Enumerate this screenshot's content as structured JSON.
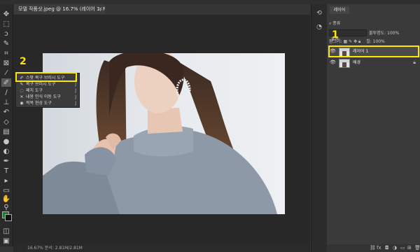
{
  "document": {
    "tab_title": "모델 작품샷.jpeg @ 16.7% (레이어 1, RGB/8#) *",
    "close_glyph": "×"
  },
  "status": {
    "text": "16.67%  문서: 2.81M/2.81M"
  },
  "toolbar": {
    "icons": [
      "move-icon",
      "marquee-icon",
      "lasso-icon",
      "quick-select-icon",
      "crop-icon",
      "frame-icon",
      "eyedropper-icon",
      "spot-healing-brush-icon",
      "brush-icon",
      "clone-stamp-icon",
      "history-brush-icon",
      "eraser-icon",
      "gradient-icon",
      "blur-icon",
      "dodge-icon",
      "pen-icon",
      "type-icon",
      "path-select-icon",
      "rectangle-icon",
      "hand-icon",
      "zoom-icon",
      "more-icon"
    ],
    "foreground_color": "#1e7b34",
    "background_color": "#111111"
  },
  "flyout": {
    "items": [
      {
        "label": "스팟 복구 브러시 도구",
        "key": "J"
      },
      {
        "label": "복구 브러시 도구",
        "key": "J"
      },
      {
        "label": "패치 도구",
        "key": "J"
      },
      {
        "label": "내용 인식 이동 도구",
        "key": "J"
      },
      {
        "label": "적목 현상 도구",
        "key": "J"
      }
    ]
  },
  "annotations": {
    "marker1": "1",
    "marker2": "2",
    "highlight_color": "#ffe600"
  },
  "layers_panel": {
    "tab_label": "레이어",
    "filter_label": "종류",
    "blend_mode": "표준",
    "opacity_label": "불투명도:",
    "opacity_value": "100%",
    "lock_label": "잠그기:",
    "fill_label": "칠:",
    "fill_value": "100%",
    "layers": [
      {
        "name": "레이어 1",
        "visible": true,
        "locked": false,
        "selected": true
      },
      {
        "name": "배경",
        "visible": true,
        "locked": true,
        "selected": false
      }
    ]
  }
}
